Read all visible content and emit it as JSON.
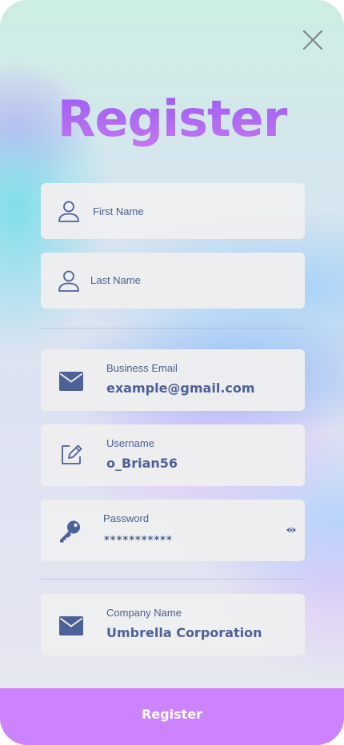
{
  "screen": {
    "title": "Register",
    "close_icon": "close-icon"
  },
  "fields": {
    "first_name": {
      "label": "First Name",
      "icon": "user-icon"
    },
    "last_name": {
      "label": "Last Name",
      "icon": "user-icon"
    },
    "business_email": {
      "label": "Business Email",
      "value": "example@gmail.com",
      "icon": "envelope-icon"
    },
    "username": {
      "label": "Username",
      "value": "o_Brian56",
      "icon": "edit-icon"
    },
    "password": {
      "label": "Password",
      "value": "***********",
      "icon": "key-icon",
      "toggle_icon": "eye-icon"
    },
    "company_name": {
      "label": "Company Name",
      "value": "Umbrella Corporation",
      "icon": "envelope-icon"
    }
  },
  "actions": {
    "register_label": "Register"
  },
  "colors": {
    "title_gradient_top": "#9a5df5",
    "title_gradient_bottom": "#c476ef",
    "button_bg": "#cd83fc",
    "field_bg": "#eeeef0",
    "field_text": "#4d6196"
  }
}
